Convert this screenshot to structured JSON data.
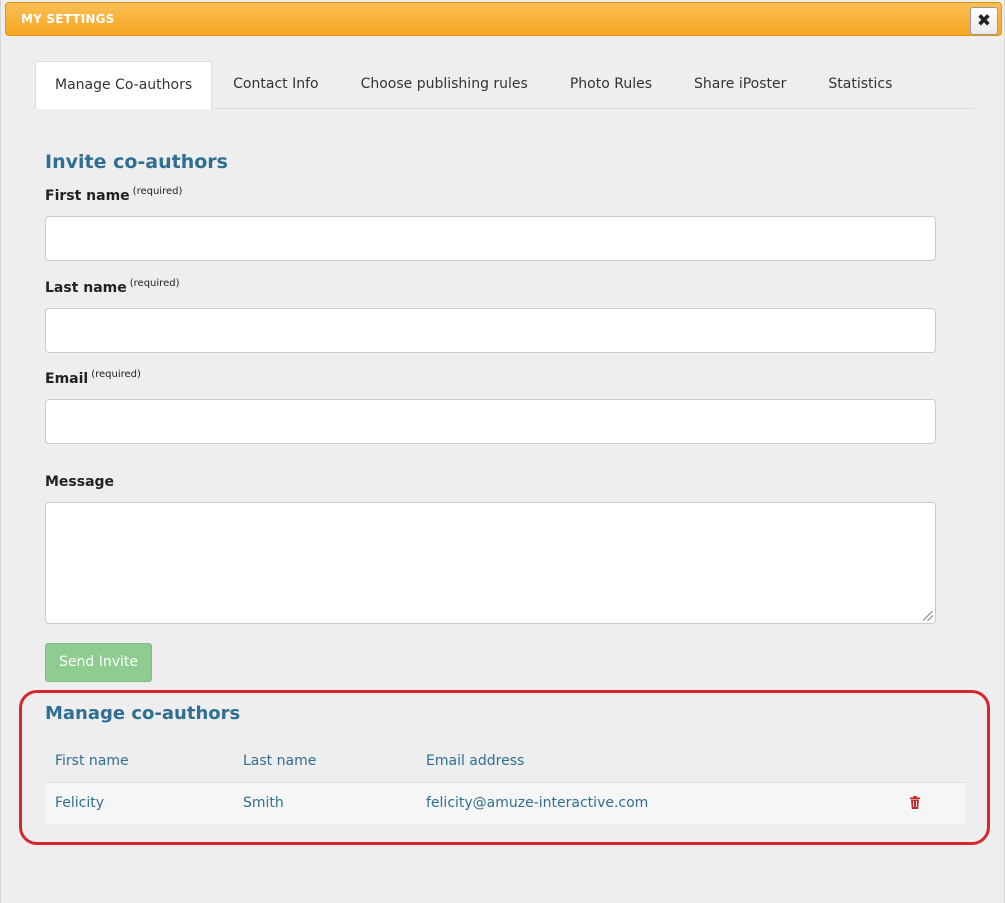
{
  "window": {
    "title": "MY SETTINGS",
    "close_icon": "close-icon"
  },
  "tabs": [
    {
      "label": "Manage Co-authors",
      "active": true
    },
    {
      "label": "Contact Info",
      "active": false
    },
    {
      "label": "Choose publishing rules",
      "active": false
    },
    {
      "label": "Photo Rules",
      "active": false
    },
    {
      "label": "Share iPoster",
      "active": false
    },
    {
      "label": "Statistics",
      "active": false
    }
  ],
  "invite": {
    "heading": "Invite co-authors",
    "first_name_label": "First name",
    "last_name_label": "Last name",
    "email_label": "Email",
    "required_note": "(required)",
    "message_label": "Message",
    "first_name_value": "",
    "last_name_value": "",
    "email_value": "",
    "message_value": "",
    "send_label": "Send Invite"
  },
  "manage": {
    "heading": "Manage co-authors",
    "columns": [
      "First name",
      "Last name",
      "Email address"
    ],
    "rows": [
      {
        "first_name": "Felicity",
        "last_name": "Smith",
        "email": "felicity@amuze-interactive.com",
        "action_icon": "trash-icon"
      }
    ]
  },
  "colors": {
    "titlebar": "#f5a623",
    "heading": "#2f6f93",
    "send_button": "#8fcc8f",
    "highlight": "#d8262d",
    "trash": "#c0282d"
  }
}
